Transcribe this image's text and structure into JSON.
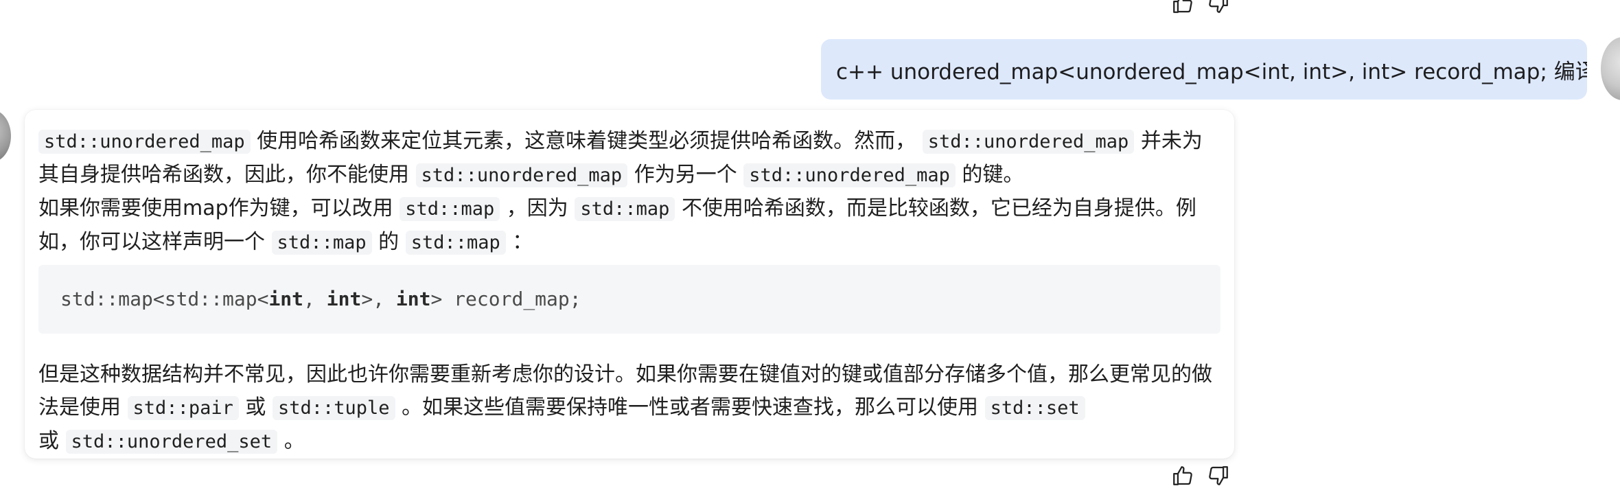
{
  "user_message": {
    "text": "c++ unordered_map<unordered_map<int, int>, int> record_map; 编译失败"
  },
  "assistant_message": {
    "p1": {
      "c1": "std::unordered_map",
      "t1": "使用哈希函数来定位其元素，这意味着键类型必须提供哈希函数。然而，",
      "c2": "std::unordered_map",
      "t2": "并未为其自身提供哈希函数，因此，你不能使用",
      "c3": "std::unordered_map",
      "t3": "作为另一个",
      "c4": "std::unordered_map",
      "t4": "的键。"
    },
    "p2": {
      "t1": "如果你需要使用map作为键，可以改用",
      "c1": "std::map",
      "t2": "，因为",
      "c2": "std::map",
      "t3": "不使用哈希函数，而是比较函数，它已经为自身提供。例如，你可以这样声明一个",
      "c3": "std::map",
      "t4": "的",
      "c4": "std::map",
      "t5": "："
    },
    "code": {
      "part1": "std::map<std::map<",
      "kw1": "int",
      "part2": ", ",
      "kw2": "int",
      "part3": ">, ",
      "kw3": "int",
      "part4": "> record_map;"
    },
    "p3": {
      "t1": "但是这种数据结构并不常见，因此也许你需要重新考虑你的设计。如果你需要在键值对的键或值部分存储多个值，那么更常见的做法是使用",
      "c1": "std::pair",
      "t2": "或",
      "c2": "std::tuple",
      "t3": "。如果这些值需要保持唯一性或者需要快速查找，那么可以使用",
      "c3": "std::set",
      "t4": "或",
      "c4": "std::unordered_set",
      "t5": "。"
    }
  },
  "icons": {
    "like": "thumbs-up-icon",
    "dislike": "thumbs-down-icon"
  }
}
